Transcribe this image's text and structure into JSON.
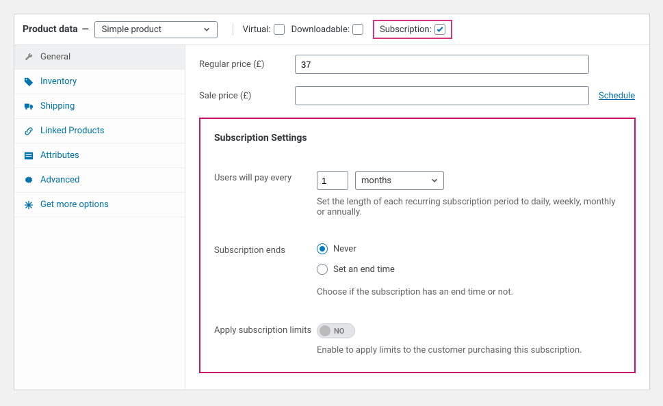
{
  "header": {
    "title": "Product data",
    "dash": "—",
    "productType": "Simple product",
    "flags": {
      "virtual": {
        "label": "Virtual:",
        "checked": false
      },
      "downloadable": {
        "label": "Downloadable:",
        "checked": false
      },
      "subscription": {
        "label": "Subscription:",
        "checked": true
      }
    }
  },
  "tabs": [
    {
      "id": "general",
      "label": "General",
      "active": true
    },
    {
      "id": "inventory",
      "label": "Inventory",
      "active": false
    },
    {
      "id": "shipping",
      "label": "Shipping",
      "active": false
    },
    {
      "id": "linked",
      "label": "Linked Products",
      "active": false
    },
    {
      "id": "attributes",
      "label": "Attributes",
      "active": false
    },
    {
      "id": "advanced",
      "label": "Advanced",
      "active": false
    },
    {
      "id": "getmore",
      "label": "Get more options",
      "active": false
    }
  ],
  "pricing": {
    "regular": {
      "label": "Regular price (£)",
      "value": "37"
    },
    "sale": {
      "label": "Sale price (£)",
      "value": ""
    },
    "scheduleLabel": "Schedule"
  },
  "subscription": {
    "title": "Subscription Settings",
    "interval": {
      "label": "Users will pay every",
      "number": "1",
      "unit": "months",
      "help": "Set the length of each recurring subscription period to daily, weekly, monthly or annually."
    },
    "ends": {
      "label": "Subscription ends",
      "options": {
        "never": "Never",
        "endtime": "Set an end time"
      },
      "selected": "never",
      "help": "Choose if the subscription has an end time or not."
    },
    "limits": {
      "label": "Apply subscription limits",
      "value": false,
      "offText": "NO",
      "help": "Enable to apply limits to the customer purchasing this subscription."
    }
  }
}
